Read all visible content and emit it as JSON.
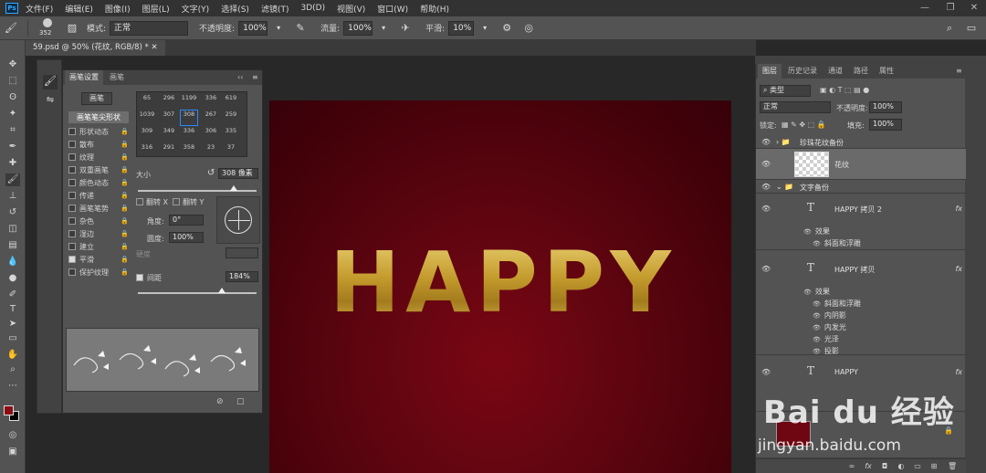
{
  "app": {
    "logo_text": "Ps"
  },
  "menu": [
    "文件(F)",
    "编辑(E)",
    "图像(I)",
    "图层(L)",
    "文字(Y)",
    "选择(S)",
    "滤镜(T)",
    "3D(D)",
    "视图(V)",
    "窗口(W)",
    "帮助(H)"
  ],
  "options": {
    "brush_size": "352",
    "mode_label": "模式:",
    "mode_value": "正常",
    "opacity_label": "不透明度:",
    "opacity_value": "100%",
    "flow_label": "流量:",
    "flow_value": "100%",
    "smooth_label": "平滑:",
    "smooth_value": "10%"
  },
  "document": {
    "tab_title": "59.psd @ 50% (花纹, RGB/8) *"
  },
  "brush_panel": {
    "tab_settings": "画笔设置",
    "tab_brush": "画笔",
    "brush_button": "画笔",
    "tip_shape": "画笔笔尖形状",
    "options": [
      {
        "label": "形状动态",
        "checked": false
      },
      {
        "label": "散布",
        "checked": false
      },
      {
        "label": "纹理",
        "checked": false
      },
      {
        "label": "双重画笔",
        "checked": false
      },
      {
        "label": "颜色动态",
        "checked": false
      },
      {
        "label": "传递",
        "checked": false
      },
      {
        "label": "画笔笔势",
        "checked": false
      },
      {
        "label": "杂色",
        "checked": false
      },
      {
        "label": "湿边",
        "checked": false
      },
      {
        "label": "建立",
        "checked": false
      },
      {
        "label": "平滑",
        "checked": true
      },
      {
        "label": "保护纹理",
        "checked": false
      }
    ],
    "presets": [
      "65",
      "296",
      "1199",
      "336",
      "619",
      "1039",
      "307",
      "308",
      "267",
      "259",
      "309",
      "349",
      "336",
      "306",
      "335",
      "316",
      "291",
      "358",
      "23",
      "37"
    ],
    "size_label": "大小",
    "size_value": "308 像素",
    "flip_x": "翻转 X",
    "flip_y": "翻转 Y",
    "angle_label": "角度:",
    "angle_value": "0°",
    "roundness_label": "圆度:",
    "roundness_value": "100%",
    "hardness_label": "硬度",
    "spacing_label": "间距",
    "spacing_value": "184%"
  },
  "canvas": {
    "text": "HAPPY"
  },
  "layers_panel": {
    "tabs": [
      "图层",
      "历史记录",
      "通道",
      "路径",
      "属性"
    ],
    "kind_label": "类型",
    "blend_mode": "正常",
    "opacity_label": "不透明度:",
    "opacity_value": "100%",
    "lock_label": "锁定:",
    "fill_label": "填充:",
    "fill_value": "100%",
    "group1": "珍珠花纹备份",
    "layer_pattern": "花纹",
    "group2": "文字备份",
    "text1": {
      "name": "HAPPY 拷贝 2",
      "effects_label": "效果",
      "effects": [
        "斜面和浮雕"
      ]
    },
    "text2": {
      "name": "HAPPY 拷贝",
      "effects_label": "效果",
      "effects": [
        "斜面和浮雕",
        "内阴影",
        "内发光",
        "光泽",
        "投影"
      ]
    },
    "text3": {
      "name": "HAPPY"
    },
    "fx": "fx"
  },
  "watermark": {
    "brand": "Bai du 经验",
    "url": "jingyan.baidu.com"
  },
  "colors": {
    "foreground": "#8b0d12",
    "background": "#000000",
    "canvas_bg": "#5e0510",
    "gold": "#c9a63a"
  }
}
